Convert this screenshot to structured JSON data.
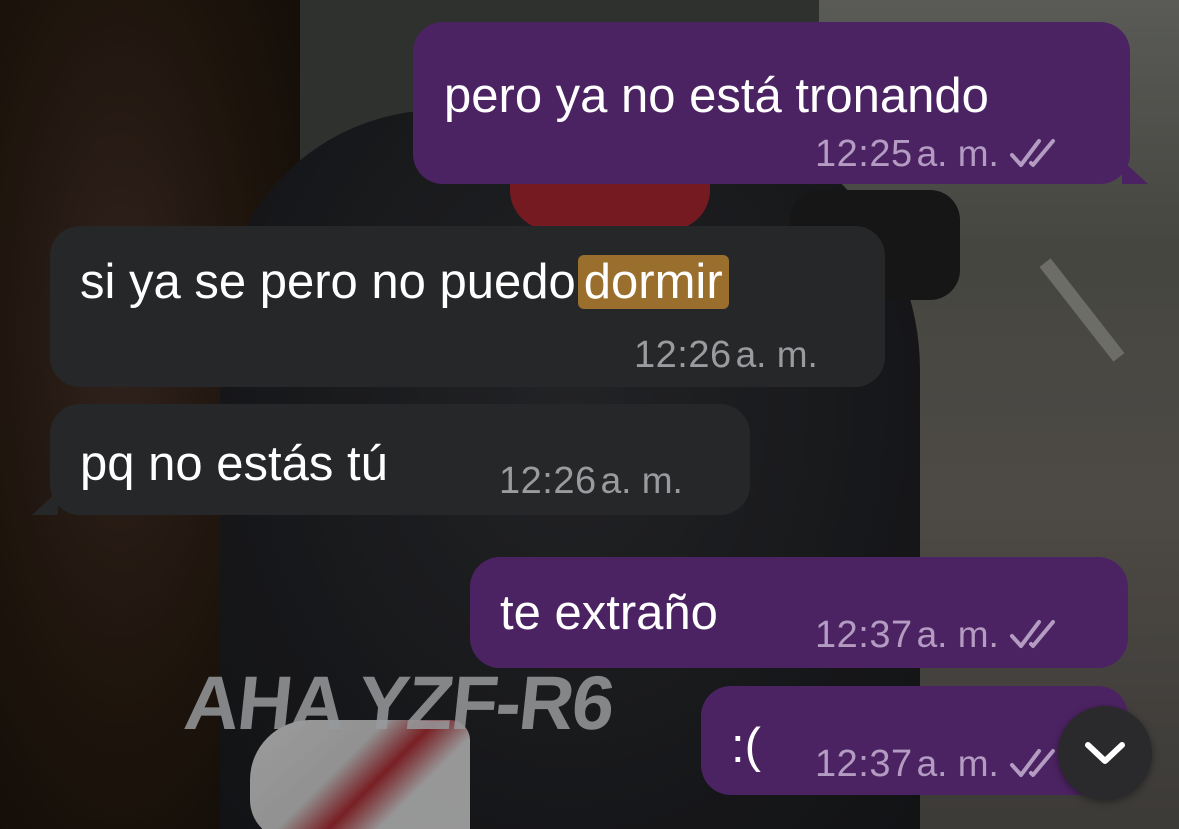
{
  "messages": [
    {
      "direction": "out",
      "text": "pero ya no está tronando",
      "time": "12:25",
      "ampm": "a. m.",
      "read": true
    },
    {
      "direction": "in",
      "text": "si ya se pero no puedo",
      "highlight": "dormir",
      "time": "12:26",
      "ampm": "a. m."
    },
    {
      "direction": "in",
      "text": "pq no estás tú",
      "time": "12:26",
      "ampm": "a. m."
    },
    {
      "direction": "out",
      "text": "te extraño",
      "time": "12:37",
      "ampm": "a. m.",
      "read": true
    },
    {
      "direction": "out",
      "text": ":(",
      "time": "12:37",
      "ampm": "a. m.",
      "read": true
    }
  ],
  "background": {
    "shirt_print": "AHA YZF-R6"
  },
  "colors": {
    "outgoing_bubble": "#4c2362",
    "incoming_bubble": "#262729",
    "highlight": "#9a6f2e"
  },
  "icons": {
    "read_receipt": "double-check-icon",
    "scroll_down": "chevron-down-icon"
  }
}
